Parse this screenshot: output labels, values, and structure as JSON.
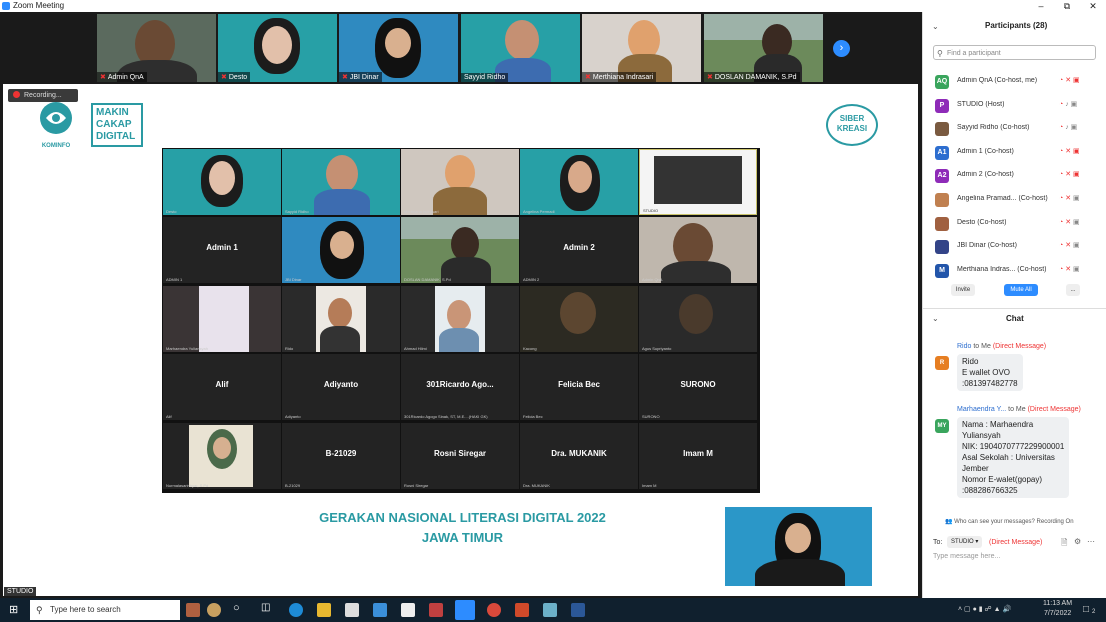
{
  "window": {
    "title": "Zoom Meeting"
  },
  "colors": {
    "zoom_blue": "#2d8cff",
    "teal": "#2a9aa3",
    "red": "#e33333",
    "taskbar": "#10202e"
  },
  "thumbnails": [
    {
      "name": "Admin QnA"
    },
    {
      "name": "Desto"
    },
    {
      "name": "JBI Dinar"
    },
    {
      "name": "Sayyid Ridho"
    },
    {
      "name": "Merthiana Indrasari"
    },
    {
      "name": "DOSLAN DAMANIK, S.Pd"
    }
  ],
  "recording": {
    "label": "Recording..."
  },
  "slide": {
    "logo_left": "KOMINFO",
    "makin_line1": "MAKIN",
    "makin_line2": "CAKAP",
    "makin_line3": "DIGITAL",
    "siber_line1": "SIBER",
    "siber_line2": "KREASI",
    "banner_line1": "GERAKAN NASIONAL LITERASI DIGITAL 2022",
    "banner_line2": "JAWA TIMUR"
  },
  "gallery": {
    "cells": [
      {
        "name": "",
        "small": "Desto"
      },
      {
        "name": "",
        "small": "Sayyid Ridho"
      },
      {
        "name": "",
        "small": "Merthiana Indrasari"
      },
      {
        "name": "",
        "small": "Angelina Permadi"
      },
      {
        "name": "",
        "small": "STUDIO"
      },
      {
        "name": "Admin 1",
        "small": "ADMIN 1"
      },
      {
        "name": "",
        "small": "JBI Dinar"
      },
      {
        "name": "",
        "small": "DOSLAN DAMANIK, S.Pd"
      },
      {
        "name": "Admin 2",
        "small": "ADMIN 2"
      },
      {
        "name": "",
        "small": "Admin QnA"
      },
      {
        "name": "",
        "small": "Marhaendra Yuliansyah"
      },
      {
        "name": "",
        "small": "Rido"
      },
      {
        "name": "",
        "small": "Ahmad Hilmi"
      },
      {
        "name": "",
        "small": "Kacong"
      },
      {
        "name": "",
        "small": "Agus Supriyanto"
      },
      {
        "name": "Alif",
        "small": "Alif"
      },
      {
        "name": "Adiyanto",
        "small": "Adiyanto"
      },
      {
        "name": "301Ricardo Ago...",
        "small": "301Ricardo Agogo Sinak, ST, M.E....(HAKI GK)"
      },
      {
        "name": "Felicia Bec",
        "small": "Felicia Bec"
      },
      {
        "name": "SURONO",
        "small": "SURONO"
      },
      {
        "name": "",
        "small": "Nurmalasarinhyar, S.Pd"
      },
      {
        "name": "B-21029",
        "small": "B-21029"
      },
      {
        "name": "Rosni Siregar",
        "small": "Rosni Siregar"
      },
      {
        "name": "Dra. MUKANIK",
        "small": "Dra. MUKANIK"
      },
      {
        "name": "Imam M",
        "small": "Imam M"
      }
    ]
  },
  "studio_label": "STUDIO",
  "participants": {
    "title": "Participants (28)",
    "search_placeholder": "Find a participant",
    "list": [
      {
        "initials": "AQ",
        "color": "#3aa55d",
        "name": "Admin QnA (Co-host, me)",
        "cam_off": true,
        "mic_muted": true
      },
      {
        "initials": "P",
        "color": "#8e2bb8",
        "name": "STUDIO (Host)",
        "cam_off": false,
        "mic_muted": false
      },
      {
        "initials": "",
        "color": "#7a5a40",
        "name": "Sayyid Ridho (Co-host)",
        "cam_off": false,
        "mic_muted": false
      },
      {
        "initials": "A1",
        "color": "#2d6ecf",
        "name": "Admin 1 (Co-host)",
        "cam_off": true,
        "mic_muted": true
      },
      {
        "initials": "A2",
        "color": "#8e2bb8",
        "name": "Admin 2 (Co-host)",
        "cam_off": true,
        "mic_muted": true
      },
      {
        "initials": "",
        "color": "#c08050",
        "name": "Angelina Pramad... (Co-host)",
        "cam_off": false,
        "mic_muted": true
      },
      {
        "initials": "",
        "color": "#a06040",
        "name": "Desto (Co-host)",
        "cam_off": false,
        "mic_muted": true
      },
      {
        "initials": "",
        "color": "#334488",
        "name": "JBI Dinar (Co-host)",
        "cam_off": false,
        "mic_muted": true
      },
      {
        "initials": "M",
        "color": "#2255aa",
        "name": "Merthiana Indras... (Co-host)",
        "cam_off": false,
        "mic_muted": true
      }
    ],
    "invite_label": "Invite",
    "mute_all_label": "Mute All",
    "more_label": "..."
  },
  "chat": {
    "title": "Chat",
    "messages": [
      {
        "sender": "Rido",
        "to": "to Me",
        "dm": "(Direct Message)",
        "initial": "R",
        "color": "#e67e22",
        "lines": [
          "Rido",
          "E wallet OVO",
          ":081397482778"
        ]
      },
      {
        "sender": "Marhaendra Y...",
        "to": "to Me",
        "dm": "(Direct Message)",
        "initial": "MY",
        "color": "#3aa55d",
        "lines": [
          "Nama : Marhaendra",
          "Yuliansyah",
          "NIK: 1904070777229900001",
          "Asal Sekolah : Universitas",
          "Jember",
          "Nomor E-walet(gopay)",
          ":088286766325"
        ]
      }
    ],
    "who_can_see": "Who can see your messages? Recording On",
    "to_label": "To:",
    "to_value": "STUDIO",
    "to_dm": "(Direct Message)",
    "input_placeholder": "Type message here..."
  },
  "taskbar": {
    "search_placeholder": "Type here to search",
    "time": "11:13 AM",
    "date": "7/7/2022",
    "notif_count": "2"
  }
}
